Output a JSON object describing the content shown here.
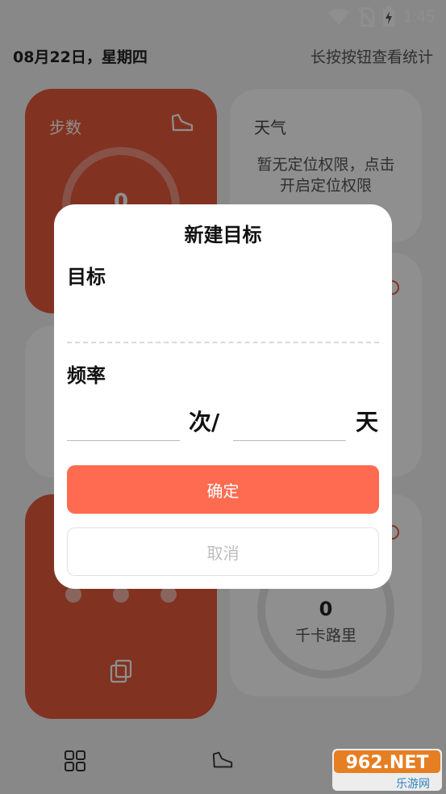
{
  "status_bar": {
    "time": "1:45"
  },
  "header": {
    "date": "08月22日，星期四",
    "hint": "长按按钮查看统计"
  },
  "cards": {
    "steps": {
      "title": "步数",
      "value": "0"
    },
    "weather": {
      "title": "天气",
      "message": "暂无定位权限，点击开启定位权限"
    },
    "calories": {
      "value": "0",
      "unit": "千卡路里"
    }
  },
  "dialog": {
    "title": "新建目标",
    "goal_label": "目标",
    "goal_value": "",
    "frequency_label": "频率",
    "times_value": "",
    "times_unit": "次/",
    "days_value": "",
    "days_unit": "天",
    "confirm_label": "确定",
    "cancel_label": "取消"
  },
  "bottom_nav": {
    "items": [
      {
        "icon": "grid-icon"
      },
      {
        "icon": "shoe-icon"
      }
    ]
  },
  "watermark": {
    "brand_text": "962.NET",
    "sub_text": "乐游网"
  },
  "colors": {
    "accent": "#ff6b50",
    "card_orange": "#e85a3c",
    "cancel_text": "#bdbdbd"
  }
}
